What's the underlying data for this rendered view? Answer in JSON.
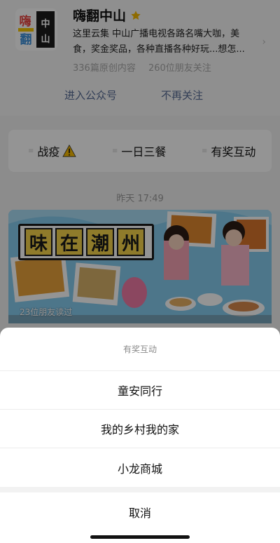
{
  "profile": {
    "name": "嗨翻中山",
    "description": "这里云集 中山广播电视各路名嘴大咖，美食，奖金奖品，各种直播各种好玩...想怎...",
    "stats": {
      "articles": "336篇原创内容",
      "friends": "260位朋友关注"
    },
    "actions": {
      "enter": "进入公众号",
      "unfollow": "不再关注"
    },
    "avatar_text": {
      "top": "中山",
      "side": "嗨",
      "bottom": "翻"
    }
  },
  "menu": {
    "items": [
      {
        "label": "战疫"
      },
      {
        "label": "一日三餐"
      },
      {
        "label": "有奖互动"
      }
    ]
  },
  "feed": {
    "timestamp": "昨天 17:49",
    "article": {
      "title_chars": [
        "味",
        "在",
        "潮",
        "州"
      ],
      "readers": "23位朋友读过"
    }
  },
  "sheet": {
    "title": "有奖互动",
    "options": [
      "童安同行",
      "我的乡村我的家",
      "小龙商城"
    ],
    "cancel": "取消"
  },
  "colors": {
    "link": "#576b95",
    "muted": "#a9a9a9",
    "star": "#f5b800",
    "warning": "#f5b800"
  }
}
